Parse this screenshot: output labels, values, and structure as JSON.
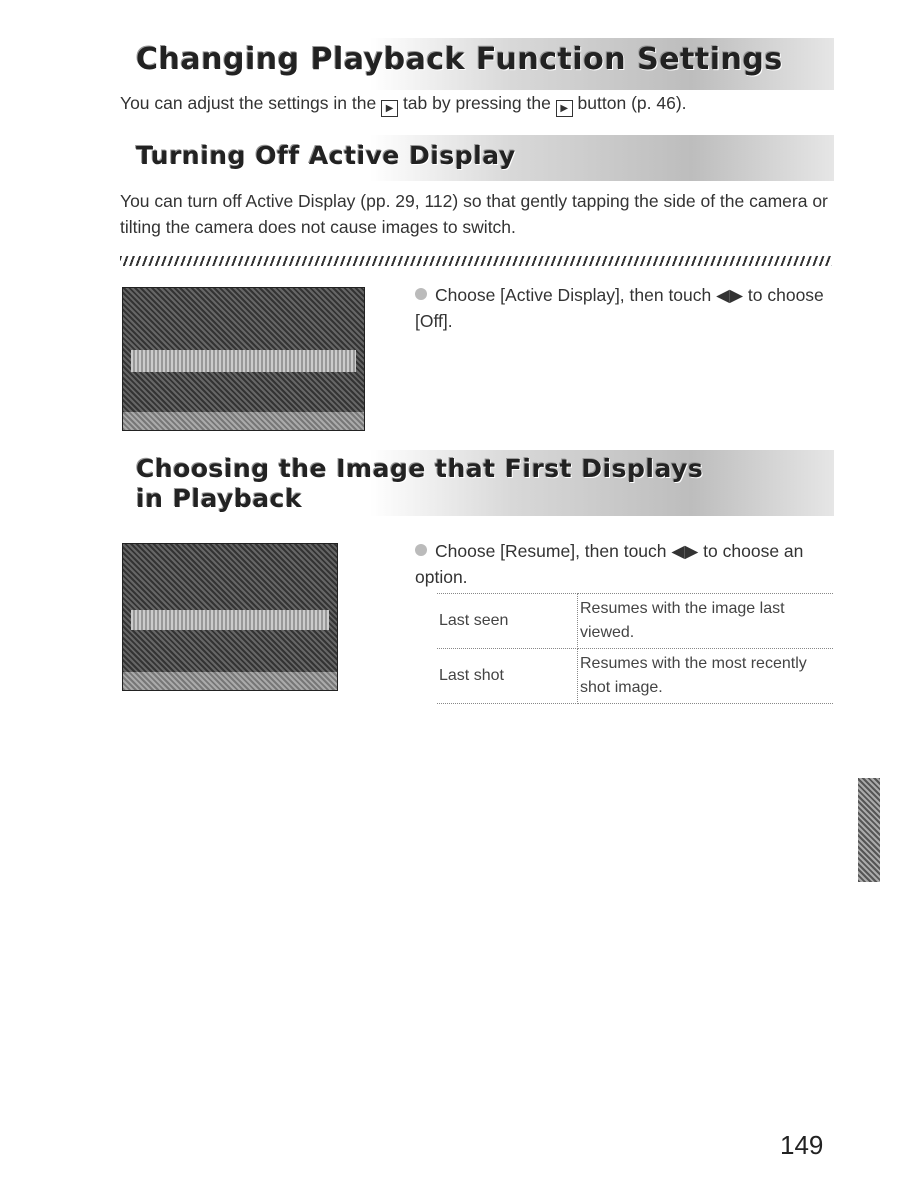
{
  "section1": {
    "title": "Changing Playback Function Settings",
    "intro_before": "You can adjust the settings in the ",
    "intro_mid": " tab by pressing the ",
    "intro_after": " button (p. 46).",
    "icon": "playback-icon"
  },
  "section2": {
    "title": "Turning Off Active Display",
    "body": "You can turn off Active Display (pp. 29, 112) so that gently tapping the side of the camera  or tilting the camera does not cause images to switch.",
    "step": "Choose [Active Display], then touch ◀▶ to choose [Off]."
  },
  "section3": {
    "title_line1": "Choosing the Image that First Displays",
    "title_line2": "in Playback",
    "step": "Choose [Resume], then touch ◀▶ to choose an option.",
    "table": [
      {
        "option": "Last seen",
        "desc": "Resumes with the image last viewed."
      },
      {
        "option": "Last shot",
        "desc": "Resumes with the most recently shot image."
      }
    ]
  },
  "page_number": "149"
}
